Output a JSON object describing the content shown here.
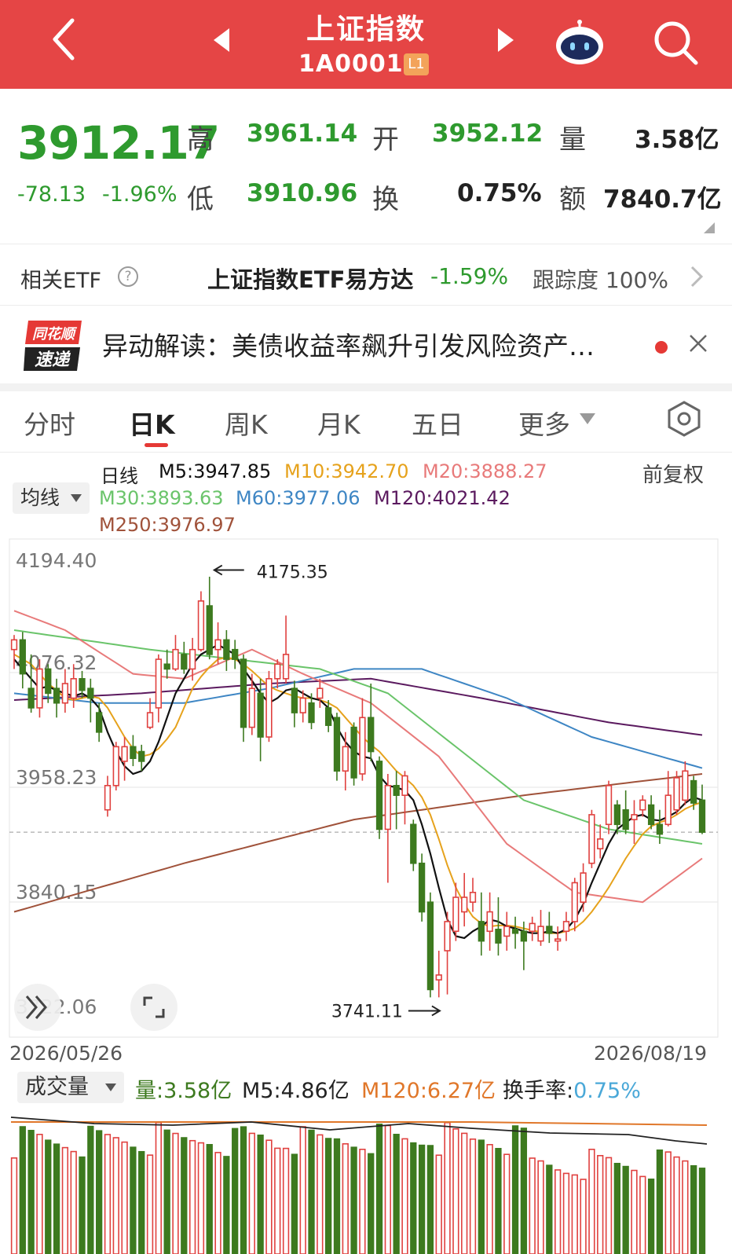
{
  "header": {
    "title": "上证指数",
    "code": "1A0001",
    "level_badge": "L1"
  },
  "quote": {
    "price": "3912.17",
    "change": "-78.13",
    "change_pct": "-1.96%",
    "high_label": "高",
    "high": "3961.14",
    "low_label": "低",
    "low": "3910.96",
    "open_label": "开",
    "open": "3952.12",
    "turnover_label": "换",
    "turnover": "0.75%",
    "volume_label": "量",
    "volume": "3.58亿",
    "amount_label": "额",
    "amount": "7840.7亿"
  },
  "etf": {
    "label": "相关ETF",
    "name": "上证指数ETF易方达",
    "change": "-1.59%",
    "track_label": "跟踪度",
    "track_value": "100%"
  },
  "news": {
    "logo_top": "同花顺",
    "logo_bottom": "速递",
    "text": "异动解读：美债收益率飙升引发风险资产…"
  },
  "tabs": [
    {
      "label": "分时"
    },
    {
      "label": "日K"
    },
    {
      "label": "周K"
    },
    {
      "label": "月K"
    },
    {
      "label": "五日"
    },
    {
      "label": "更多"
    }
  ],
  "ma_legend": {
    "dropdown": "均线",
    "line_type": "日线",
    "m5": "M5:3947.85",
    "m10": "M10:3942.70",
    "m20": "M20:3888.27",
    "m30": "M30:3893.63",
    "m60": "M60:3977.06",
    "m120": "M120:4021.42",
    "m250": "M250:3976.97",
    "adjust": "前复权"
  },
  "colors": {
    "header_bg": "#e54545",
    "up": "#e0413f",
    "down": "#3d7a1f",
    "m5": "#111111",
    "m10": "#e6a21c",
    "m20": "#e87a7a",
    "m30": "#6ac46a",
    "m60": "#3e86c4",
    "m120": "#5b1a5f",
    "m250": "#a0523a"
  },
  "chart_data": {
    "type": "candlestick",
    "y_ticks": [
      "4194.40",
      "4076.32",
      "3958.23",
      "3840.15",
      "3722.06"
    ],
    "ylim": [
      3722.06,
      4194.4
    ],
    "annotations": {
      "high": "4175.35",
      "low": "3741.11"
    },
    "date_start": "2026/05/26",
    "date_end": "2026/08/19",
    "candles": [
      [
        4100,
        4110,
        4115,
        4080
      ],
      [
        4110,
        4075,
        4118,
        4060
      ],
      [
        4060,
        4040,
        4095,
        4035
      ],
      [
        4040,
        4080,
        4090,
        4030
      ],
      [
        4080,
        4055,
        4085,
        4045
      ],
      [
        4060,
        4045,
        4070,
        4030
      ],
      [
        4045,
        4065,
        4080,
        4035
      ],
      [
        4050,
        4070,
        4085,
        4040
      ],
      [
        4070,
        4058,
        4078,
        4050
      ],
      [
        4060,
        4050,
        4070,
        4025
      ],
      [
        4035,
        4015,
        4045,
        4005
      ],
      [
        3935,
        3960,
        3970,
        3928
      ],
      [
        3960,
        4000,
        4005,
        3955
      ],
      [
        3985,
        4000,
        4010,
        3965
      ],
      [
        4000,
        3988,
        4012,
        3980
      ],
      [
        3995,
        3985,
        4002,
        3975
      ],
      [
        4020,
        4035,
        4050,
        4018
      ],
      [
        4040,
        4090,
        4095,
        4025
      ],
      [
        4085,
        4080,
        4100,
        4070
      ],
      [
        4080,
        4100,
        4115,
        4078
      ],
      [
        4095,
        4080,
        4108,
        4075
      ],
      [
        4080,
        4100,
        4112,
        4068
      ],
      [
        4100,
        4150,
        4160,
        4098
      ],
      [
        4145,
        4095,
        4175,
        4090
      ],
      [
        4100,
        4110,
        4128,
        4085
      ],
      [
        4110,
        4090,
        4120,
        4078
      ],
      [
        4100,
        4090,
        4110,
        4080
      ],
      [
        4090,
        4020,
        4095,
        4005
      ],
      [
        4020,
        4060,
        4075,
        4012
      ],
      [
        4055,
        4010,
        4070,
        3985
      ],
      [
        4010,
        4070,
        4078,
        4005
      ],
      [
        4070,
        4085,
        4090,
        4060
      ],
      [
        4070,
        4095,
        4135,
        4065
      ],
      [
        4060,
        4035,
        4068,
        4020
      ],
      [
        4035,
        4050,
        4058,
        4025
      ],
      [
        4045,
        4025,
        4055,
        4018
      ],
      [
        4050,
        4060,
        4070,
        4040
      ],
      [
        4040,
        4022,
        4048,
        4015
      ],
      [
        4030,
        3975,
        4035,
        3965
      ],
      [
        3975,
        4000,
        4015,
        3955
      ],
      [
        4020,
        3968,
        4025,
        3960
      ],
      [
        3972,
        4030,
        4050,
        3965
      ],
      [
        4030,
        3995,
        4065,
        3985
      ],
      [
        3985,
        3915,
        3990,
        3905
      ],
      [
        3915,
        3960,
        3972,
        3860
      ],
      [
        3960,
        3950,
        3975,
        3915
      ],
      [
        3950,
        3970,
        3975,
        3920
      ],
      [
        3920,
        3880,
        3925,
        3872
      ],
      [
        3880,
        3830,
        3890,
        3820
      ],
      [
        3840,
        3750,
        3850,
        3742
      ],
      [
        3760,
        3765,
        3790,
        3742
      ],
      [
        3790,
        3820,
        3830,
        3745
      ],
      [
        3810,
        3845,
        3860,
        3800
      ],
      [
        3830,
        3845,
        3870,
        3815
      ],
      [
        3840,
        3850,
        3865,
        3830
      ],
      [
        3820,
        3800,
        3850,
        3785
      ],
      [
        3810,
        3830,
        3850,
        3790
      ],
      [
        3812,
        3798,
        3845,
        3785
      ],
      [
        3805,
        3815,
        3830,
        3790
      ],
      [
        3812,
        3808,
        3825,
        3792
      ],
      [
        3810,
        3800,
        3820,
        3770
      ],
      [
        3810,
        3818,
        3825,
        3800
      ],
      [
        3800,
        3815,
        3832,
        3795
      ],
      [
        3815,
        3808,
        3830,
        3798
      ],
      [
        3800,
        3802,
        3815,
        3790
      ],
      [
        3810,
        3820,
        3830,
        3800
      ],
      [
        3820,
        3860,
        3865,
        3810
      ],
      [
        3840,
        3870,
        3880,
        3830
      ],
      [
        3880,
        3930,
        3935,
        3875
      ],
      [
        3895,
        3905,
        3920,
        3885
      ],
      [
        3920,
        3960,
        3965,
        3910
      ],
      [
        3940,
        3920,
        3945,
        3910
      ],
      [
        3935,
        3915,
        3955,
        3910
      ],
      [
        3925,
        3930,
        3945,
        3900
      ],
      [
        3935,
        3945,
        3950,
        3928
      ],
      [
        3940,
        3920,
        3950,
        3915
      ],
      [
        3920,
        3910,
        3935,
        3900
      ],
      [
        3920,
        3950,
        3975,
        3918
      ],
      [
        3935,
        3968,
        3975,
        3930
      ],
      [
        3945,
        3975,
        3985,
        3940
      ],
      [
        3965,
        3942,
        3970,
        3935
      ],
      [
        3945,
        3912,
        3961,
        3910
      ]
    ],
    "ma5": [
      4090,
      4080,
      4070,
      4060,
      4062,
      4058,
      4055,
      4052,
      4055,
      4050,
      4040,
      4015,
      3995,
      3980,
      3972,
      3975,
      3985,
      4005,
      4030,
      4055,
      4070,
      4085,
      4095,
      4100,
      4105,
      4100,
      4095,
      4080,
      4068,
      4055,
      4045,
      4050,
      4058,
      4060,
      4055,
      4050,
      4048,
      4040,
      4020,
      4005,
      3995,
      3990,
      3988,
      3970,
      3960,
      3958,
      3955,
      3945,
      3920,
      3890,
      3855,
      3822,
      3805,
      3803,
      3810,
      3815,
      3822,
      3820,
      3815,
      3813,
      3810,
      3808,
      3808,
      3810,
      3808,
      3812,
      3822,
      3838,
      3860,
      3880,
      3900,
      3915,
      3922,
      3928,
      3930,
      3925,
      3924,
      3928,
      3933,
      3942,
      3948,
      3945
    ],
    "ma10": [
      4095,
      4090,
      4085,
      4075,
      4065,
      4058,
      4050,
      4048,
      4050,
      4052,
      4050,
      4040,
      4025,
      4010,
      3998,
      3990,
      3992,
      3998,
      4008,
      4020,
      4040,
      4060,
      4072,
      4082,
      4090,
      4092,
      4090,
      4085,
      4078,
      4070,
      4062,
      4058,
      4055,
      4052,
      4050,
      4050,
      4048,
      4045,
      4040,
      4030,
      4020,
      4010,
      4002,
      3995,
      3985,
      3975,
      3968,
      3960,
      3948,
      3930,
      3905,
      3878,
      3855,
      3838,
      3825,
      3818,
      3815,
      3816,
      3816,
      3815,
      3813,
      3811,
      3809,
      3808,
      3808,
      3810,
      3813,
      3820,
      3830,
      3842,
      3855,
      3870,
      3885,
      3898,
      3910,
      3918,
      3922,
      3925,
      3930,
      3936,
      3940,
      3943
    ]
  }
}
